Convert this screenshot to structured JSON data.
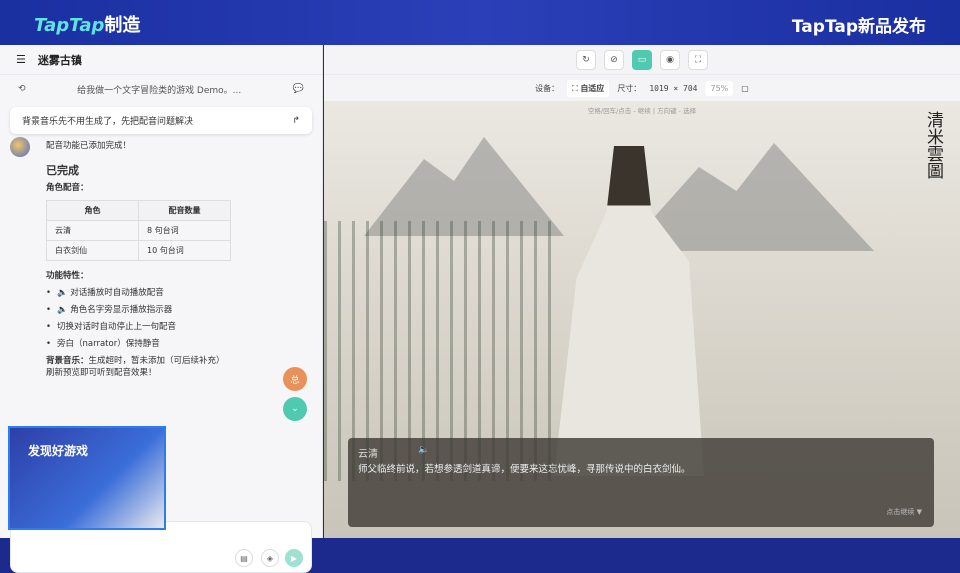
{
  "banner": {
    "logo_brand": "TapTap",
    "logo_suffix": "制造",
    "event": "TapTap新品发布"
  },
  "left": {
    "project_title": "迷雾古镇",
    "history_prompt": "给我做一个文字冒险类的游戏 Demo。...",
    "queued_message": "背景音乐先不用生成了，先把配音问题解决",
    "reply": {
      "intro": "配音功能已添加完成！",
      "done_heading": "已完成",
      "voice_heading": "角色配音：",
      "table": {
        "headers": [
          "角色",
          "配音数量"
        ],
        "rows": [
          [
            "云清",
            "8 句台词"
          ],
          [
            "白衣剑仙",
            "10 句台词"
          ]
        ]
      },
      "features_heading": "功能特性：",
      "features": [
        "🔈 对话播放时自动播放配音",
        "🔈 角色名字旁显示播放指示器",
        "切换对话时自动停止上一句配音",
        "旁白（narrator）保持静音"
      ],
      "bgm_label": "背景音乐：",
      "bgm_text": "生成超时，暂未添加（可后续补充）",
      "refresh": "刷新预览即可听到配音效果！"
    },
    "fab_label": "总"
  },
  "camera": {
    "overlay_text": "发现好游戏"
  },
  "right": {
    "device_label": "设备：",
    "device_value": "自适应",
    "size_label": "尺寸：",
    "size_value": "1019 × 704",
    "zoom": "75%",
    "game": {
      "hint": "空格/回车/点击 - 继续 | 方向键 - 选择",
      "calligraphy": "清米雲圖",
      "speaker": "云清",
      "line": "师父临终前说，若想参透剑道真谛，便要来这忘忧峰，寻那传说中的白衣剑仙。",
      "continue": "点击继续 ▼"
    }
  },
  "colors": {
    "accent": "#4fc9b0",
    "banner": "#1a2fa0"
  }
}
